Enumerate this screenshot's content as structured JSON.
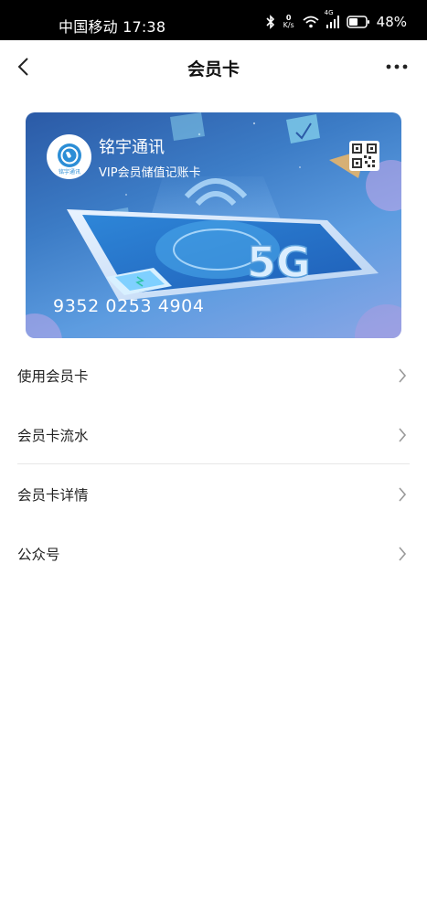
{
  "status_bar": {
    "carrier_time": "中国移动 17:38",
    "net_speed_value": "0",
    "net_speed_unit": "K/s",
    "signal_label": "4G",
    "battery_percent": "48%",
    "icons": [
      "bluetooth-icon",
      "wifi-icon",
      "signal-icon",
      "battery-icon"
    ]
  },
  "navbar": {
    "title": "会员卡",
    "back_icon": "back-arrow-icon",
    "more_icon": "more-icon"
  },
  "card": {
    "brand_name": "铭宇通讯",
    "card_type": "VIP会员储值记账卡",
    "card_number": "9352 0253 4904",
    "logo_text": "铭宇通讯",
    "illustration_text": "5G",
    "qr_icon": "qr-code-icon",
    "colors": {
      "gradient_start": "#2b5aa6",
      "gradient_end": "#8aa6e6"
    }
  },
  "menu": {
    "items": [
      {
        "label": "使用会员卡"
      },
      {
        "label": "会员卡流水"
      },
      {
        "label": "会员卡详情"
      },
      {
        "label": "公众号"
      }
    ]
  }
}
